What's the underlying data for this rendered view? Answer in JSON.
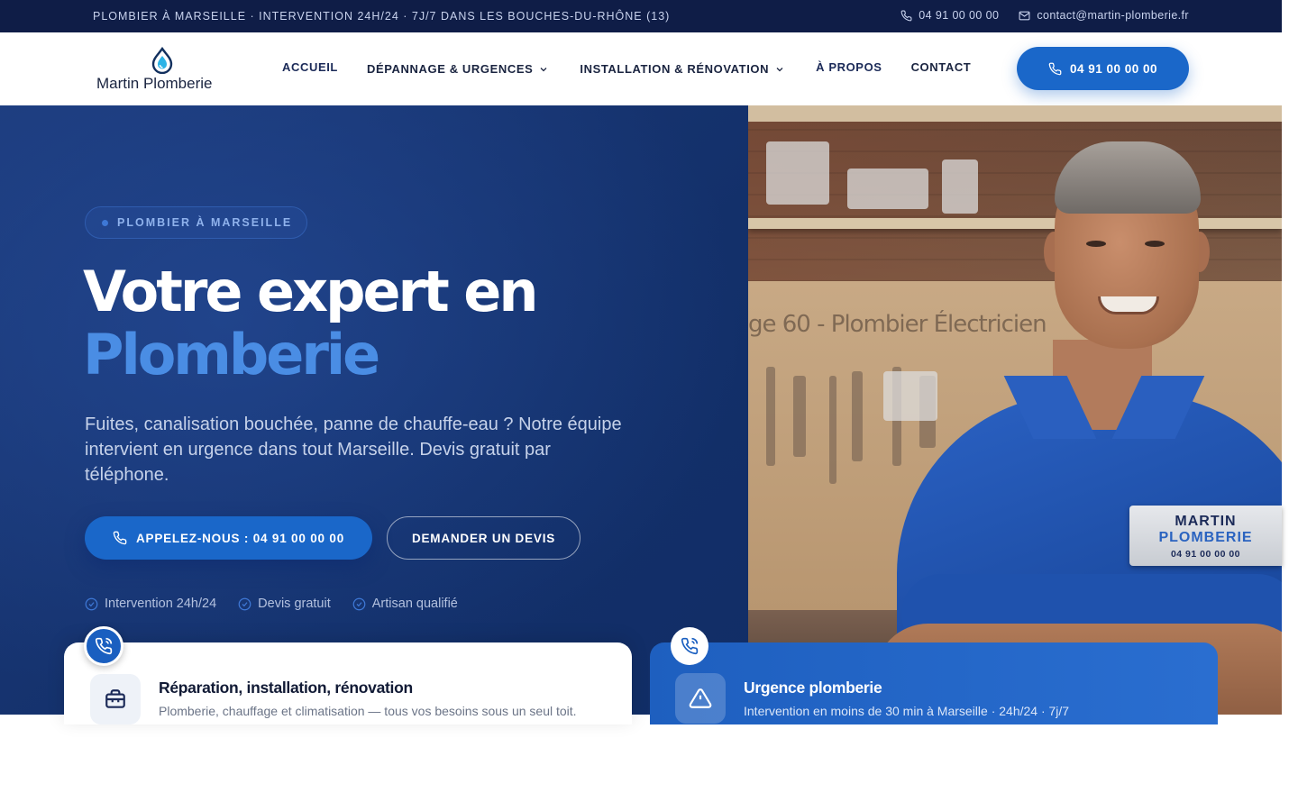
{
  "topbar": {
    "tagline": "PLOMBIER À MARSEILLE · INTERVENTION 24H/24 · 7J/7 DANS LES BOUCHES-DU-RHÔNE (13)",
    "phone": "04 91 00 00 00",
    "email": "contact@martin-plomberie.fr",
    "icons": [
      "phone-icon",
      "mail-icon"
    ]
  },
  "header": {
    "logo_text": "Martin Plomberie",
    "logo_icon": "water-drop-icon",
    "nav": {
      "accueil": "ACCUEIL",
      "depannage": "DÉPANNAGE & URGENCES",
      "installation": "INSTALLATION & RÉNOVATION",
      "apropos": "À PROPOS",
      "contact": "CONTACT"
    },
    "cta_phone": "04 91 00 00 00"
  },
  "hero": {
    "badge": "PLOMBIER À MARSEILLE",
    "title_line1": "Votre expert en",
    "title_line2": "Plomberie",
    "lead": "Fuites, canalisation bouchée, panne de chauffe-eau ? Notre équipe intervient en urgence dans tout Marseille. Devis gratuit par téléphone.",
    "btn_call": "APPELEZ-NOUS : 04 91 00 00 00",
    "btn_quote": "DEMANDER UN DEVIS",
    "features": [
      "Intervention 24h/24",
      "Devis gratuit",
      "Artisan qualifié"
    ],
    "photo_sign": "ge 60 - Plombier Électricien",
    "name_badge": {
      "line1": "MARTIN",
      "line2": "PLOMBERIE",
      "line3": "04 91 00 00 00"
    }
  },
  "cards": {
    "left": {
      "title": "Réparation, installation, rénovation",
      "subtitle": "Plomberie, chauffage et climatisation — tous vos besoins sous un seul toit.",
      "icon": "toolbox-icon"
    },
    "right": {
      "title": "Urgence plomberie",
      "subtitle": "Intervention en moins de 30 min à Marseille · 24h/24 · 7j/7",
      "icon": "warning-icon"
    }
  },
  "colors": {
    "navy": "#0f1d47",
    "brand_blue": "#1a67c9",
    "accent_light_blue": "#4a8de4",
    "hero_bg": "#13306a"
  }
}
